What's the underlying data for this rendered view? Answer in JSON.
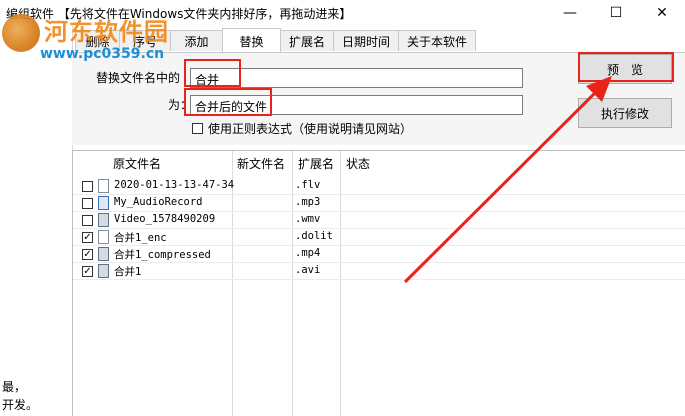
{
  "window": {
    "title": "编组软件 【先将文件在Windows文件夹内排好序，再拖动进来】",
    "controls": {
      "minimize": "—",
      "maximize": "☐",
      "close": "✕"
    }
  },
  "tabs": [
    "删除",
    "序号",
    "添加",
    "替换",
    "扩展名",
    "日期时间",
    "关于本软件"
  ],
  "active_tab": "替换",
  "replace_panel": {
    "find_label": "替换文件名中的",
    "find_value": "合并",
    "replace_label": "为：",
    "replace_value": "合并后的文件",
    "regex_label": "使用正则表达式（使用说明请见网站）",
    "regex_checked": false
  },
  "buttons": {
    "preview": "预　览",
    "execute": "执行修改"
  },
  "file_list": {
    "columns": [
      "原文件名",
      "新文件名",
      "扩展名",
      "状态"
    ],
    "rows": [
      {
        "checked": false,
        "icon": "document-icon",
        "name": "2020-01-13-13-47-34",
        "new_name": "",
        "ext": ".flv",
        "status": ""
      },
      {
        "checked": false,
        "icon": "audio-file-icon",
        "name": "My_AudioRecord",
        "new_name": "",
        "ext": ".mp3",
        "status": ""
      },
      {
        "checked": false,
        "icon": "video-file-icon",
        "name": "Video_1578490209",
        "new_name": "",
        "ext": ".wmv",
        "status": ""
      },
      {
        "checked": true,
        "icon": "document-icon",
        "name": "合并1_enc",
        "new_name": "",
        "ext": ".dolit",
        "status": ""
      },
      {
        "checked": true,
        "icon": "video-file-icon",
        "name": "合并1_compressed",
        "new_name": "",
        "ext": ".mp4",
        "status": ""
      },
      {
        "checked": true,
        "icon": "video-file-icon",
        "name": "合并1",
        "new_name": "",
        "ext": ".avi",
        "status": ""
      }
    ]
  },
  "left_pane": {
    "text": "最，\n开发。"
  },
  "watermark": {
    "name": "河东软件园",
    "url": "www.pc0359.cn"
  },
  "annotation_color": "#e8231a"
}
